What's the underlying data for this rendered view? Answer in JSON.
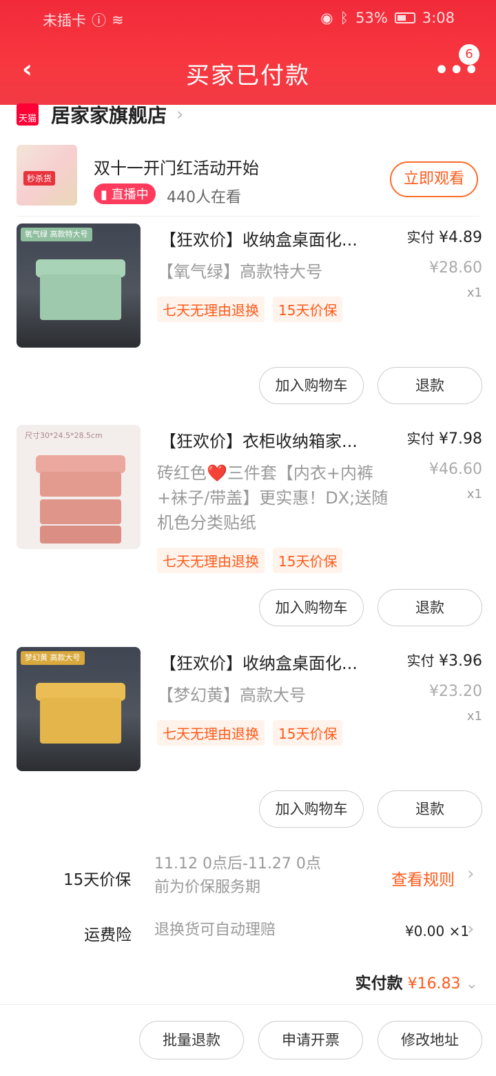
{
  "status_bar": {
    "carrier": "未插卡",
    "battery": "53%",
    "time": "3:08"
  },
  "header": {
    "title": "买家已付款",
    "back_icon": "chevron-left-icon",
    "more_icon": "more-dots-icon",
    "badge_count": "6"
  },
  "store": {
    "logo_text": "天猫",
    "name": "居家家旗舰店"
  },
  "live": {
    "thumb_tag": "秒杀货",
    "title": "双十一开门红活动开始",
    "badge": "直播中",
    "viewers": "440人在看",
    "watch_button": "立即观看"
  },
  "products": [
    {
      "title": "【狂欢价】收纳盒桌面化...",
      "sku": "【氧气绿】高款特大号",
      "img_label": "氧气绿 高款特大号",
      "tags": [
        "七天无理由退换",
        "15天价保"
      ],
      "paid_label": "实付",
      "paid": "¥4.89",
      "original": "¥28.60",
      "qty": "x1",
      "btn_cart": "加入购物车",
      "btn_refund": "退款"
    },
    {
      "title": "【狂欢价】衣柜收纳箱家...",
      "sku": "砖红色❤️三件套【内衣+内裤+袜子/带盖】更实惠！DX;送随机色分类贴纸",
      "img_label": "尺寸30*24.5*28.5cm",
      "tags": [
        "七天无理由退换",
        "15天价保"
      ],
      "paid_label": "实付",
      "paid": "¥7.98",
      "original": "¥46.60",
      "qty": "x1",
      "btn_cart": "加入购物车",
      "btn_refund": "退款"
    },
    {
      "title": "【狂欢价】收纳盒桌面化...",
      "sku": "【梦幻黄】高款大号",
      "img_label": "梦幻黄 高款大号",
      "tags": [
        "七天无理由退换",
        "15天价保"
      ],
      "paid_label": "实付",
      "paid": "¥3.96",
      "original": "¥23.20",
      "qty": "x1",
      "btn_cart": "加入购物车",
      "btn_refund": "退款"
    }
  ],
  "price_protect": {
    "label": "15天价保",
    "text": "11.12 0点后-11.27 0点前为价保服务期",
    "link": "查看规则"
  },
  "shipping_insurance": {
    "label": "运费险",
    "text": "退换货可自动理赔",
    "value": "¥0.00 ×1"
  },
  "total": {
    "label": "实付款",
    "amount": "¥16.83"
  },
  "footer": {
    "batch_refund": "批量退款",
    "invoice": "申请开票",
    "modify_address": "修改地址"
  },
  "colors": {
    "brand_red": "#f22a3a",
    "accent_orange": "#ff5a1a",
    "green_box": "#9ec9ad",
    "pink_box": "#e9a59a",
    "yellow_box": "#e3b54a"
  }
}
